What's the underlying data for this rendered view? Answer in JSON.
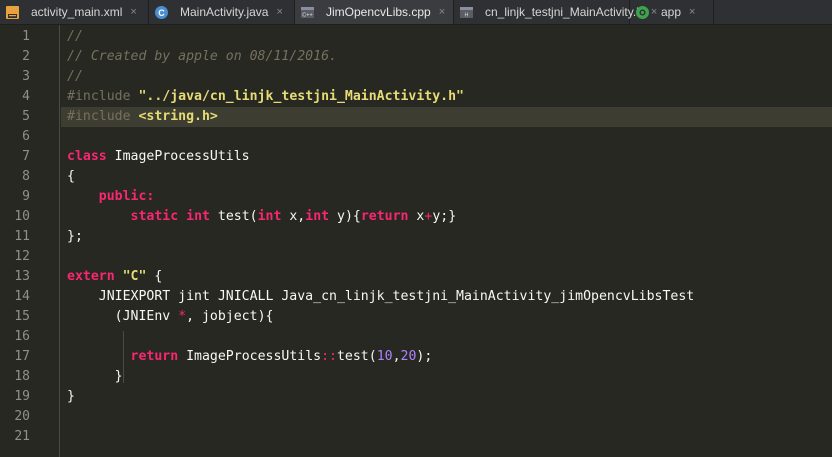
{
  "tabs": [
    {
      "label": "activity_main.xml",
      "icon": "xml-file-icon",
      "active": false
    },
    {
      "label": "MainActivity.java",
      "icon": "java-class-icon",
      "active": false
    },
    {
      "label": "JimOpencvLibs.cpp",
      "icon": "cpp-file-icon",
      "active": true
    },
    {
      "label": "cn_linjk_testjni_MainActivity.h",
      "icon": "header-file-icon",
      "active": false
    },
    {
      "label": "app",
      "icon": "android-module-icon",
      "active": false
    }
  ],
  "close_glyph": "×",
  "highlighted_line": 5,
  "lines": [
    [
      {
        "t": "//",
        "c": "cm"
      }
    ],
    [
      {
        "t": "// Created by apple on 08/11/2016.",
        "c": "cm"
      }
    ],
    [
      {
        "t": "//",
        "c": "cm"
      }
    ],
    [
      {
        "t": "#include ",
        "c": "pp"
      },
      {
        "t": "\"../java/cn_linjk_testjni_MainActivity.h\"",
        "c": "str"
      }
    ],
    [
      {
        "t": "#include ",
        "c": "pp"
      },
      {
        "t": "<string.h>",
        "c": "str"
      }
    ],
    [],
    [
      {
        "t": "class",
        "c": "kw"
      },
      {
        "t": " ImageProcessUtils",
        "c": "pl"
      }
    ],
    [
      {
        "t": "{",
        "c": "pl"
      }
    ],
    [
      {
        "t": "    ",
        "c": "pl"
      },
      {
        "t": "public:",
        "c": "kw"
      }
    ],
    [
      {
        "t": "        ",
        "c": "pl"
      },
      {
        "t": "static",
        "c": "kw"
      },
      {
        "t": " ",
        "c": "pl"
      },
      {
        "t": "int",
        "c": "kw"
      },
      {
        "t": " test(",
        "c": "pl"
      },
      {
        "t": "int",
        "c": "kw"
      },
      {
        "t": " x,",
        "c": "pl"
      },
      {
        "t": "int",
        "c": "kw"
      },
      {
        "t": " y){",
        "c": "pl"
      },
      {
        "t": "return",
        "c": "kw"
      },
      {
        "t": " x",
        "c": "pl"
      },
      {
        "t": "+",
        "c": "op"
      },
      {
        "t": "y;}",
        "c": "pl"
      }
    ],
    [
      {
        "t": "};",
        "c": "pl"
      }
    ],
    [],
    [
      {
        "t": "extern",
        "c": "kw"
      },
      {
        "t": " ",
        "c": "pl"
      },
      {
        "t": "\"C\"",
        "c": "str"
      },
      {
        "t": " {",
        "c": "pl"
      }
    ],
    [
      {
        "t": "    JNIEXPORT jint JNICALL Java_cn_linjk_testjni_MainActivity_jimOpencvLibsTest",
        "c": "pl"
      }
    ],
    [
      {
        "t": "      (JNIEnv ",
        "c": "pl"
      },
      {
        "t": "*",
        "c": "op"
      },
      {
        "t": ", jobject){",
        "c": "pl"
      }
    ],
    [],
    [
      {
        "t": "        ",
        "c": "pl"
      },
      {
        "t": "return",
        "c": "kw"
      },
      {
        "t": " ImageProcessUtils",
        "c": "pl"
      },
      {
        "t": "::",
        "c": "op"
      },
      {
        "t": "test(",
        "c": "pl"
      },
      {
        "t": "10",
        "c": "num"
      },
      {
        "t": ",",
        "c": "pl"
      },
      {
        "t": "20",
        "c": "num"
      },
      {
        "t": ");",
        "c": "pl"
      }
    ],
    [
      {
        "t": "      }",
        "c": "pl"
      }
    ],
    [
      {
        "t": "}",
        "c": "pl"
      }
    ],
    [],
    []
  ]
}
